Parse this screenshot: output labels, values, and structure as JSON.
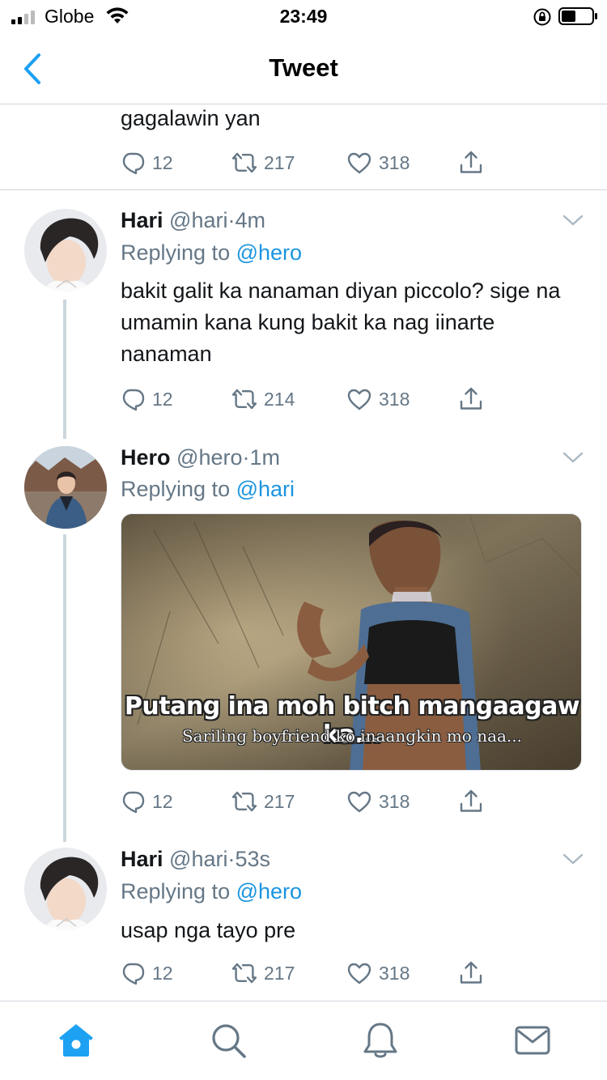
{
  "status_bar": {
    "carrier": "Globe",
    "time": "23:49",
    "signal_icon": "signal-bars-icon",
    "wifi_icon": "wifi-icon",
    "lock_icon": "rotation-lock-icon",
    "battery_icon": "battery-icon"
  },
  "nav": {
    "title": "Tweet",
    "back_icon": "chevron-left-icon"
  },
  "partial_tweet": {
    "text": "gagalawin yan",
    "reply_count": "12",
    "retweet_count": "217",
    "like_count": "318"
  },
  "tweets": [
    {
      "name": "Hari",
      "handle": "@hari",
      "dot": "·",
      "time": "4m",
      "replying_prefix": "Replying to",
      "replying_to": "@hero",
      "text": "bakit galit ka nanaman diyan piccolo? sige na umamin kana kung bakit ka nag iinarte nanaman",
      "reply_count": "12",
      "retweet_count": "214",
      "like_count": "318"
    },
    {
      "name": "Hero",
      "handle": "@hero",
      "dot": "·",
      "time": "1m",
      "replying_prefix": "Replying to",
      "replying_to": "@hari",
      "media_caption_main": "Putang ina moh bitch mangaagaw ka...",
      "media_caption_sub": "Sariling boyfriend ko inaangkin mo naa...",
      "reply_count": "12",
      "retweet_count": "217",
      "like_count": "318"
    },
    {
      "name": "Hari",
      "handle": "@hari",
      "dot": "·",
      "time": "53s",
      "replying_prefix": "Replying to",
      "replying_to": "@hero",
      "text": "usap nga tayo pre",
      "reply_count": "12",
      "retweet_count": "217",
      "like_count": "318"
    }
  ],
  "tab_bar": {
    "items": [
      "home-icon",
      "search-icon",
      "notifications-icon",
      "messages-icon"
    ],
    "active": "home-icon"
  },
  "colors": {
    "accent": "#1da1f2",
    "link": "#1b95e0",
    "muted": "#657786",
    "divider": "#cfd6dc",
    "thread_line": "#ccd6dd"
  }
}
